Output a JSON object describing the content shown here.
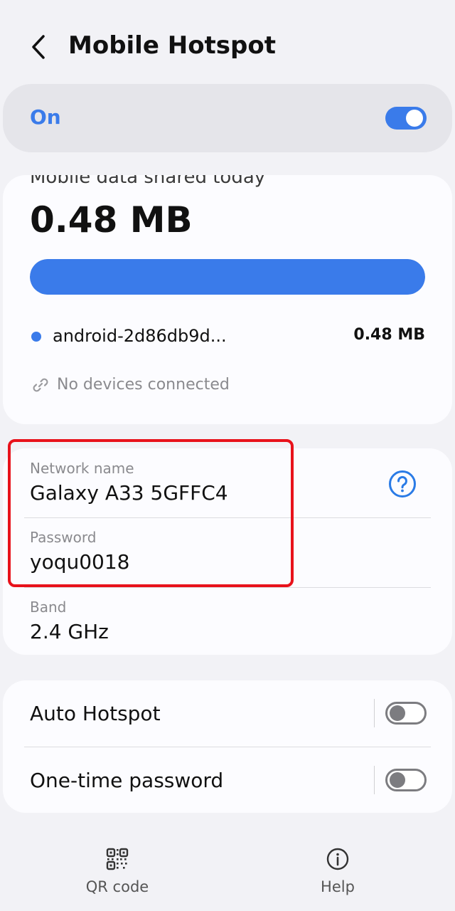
{
  "header": {
    "title": "Mobile Hotspot",
    "back_icon": "chevron-left-icon"
  },
  "master_switch": {
    "label": "On",
    "enabled": true,
    "accent_color": "#3a7bea"
  },
  "usage": {
    "caption": "Mobile data shared today",
    "total": "0.48 MB",
    "bar_fill_fraction": 1.0,
    "bar_color": "#3a7bea",
    "devices": [
      {
        "name": "android-2d86db9d...",
        "usage": "0.48 MB",
        "dot_color": "#3a7bea"
      }
    ],
    "connection_status": "No devices connected",
    "connection_icon": "link-icon"
  },
  "config": {
    "network_name_label": "Network name",
    "network_name_value": "Galaxy A33 5GFFC4",
    "password_label": "Password",
    "password_value": "yoqu0018",
    "band_label": "Band",
    "band_value": "2.4 GHz",
    "help_icon": "question-circle-icon",
    "highlight_color": "#e8121b"
  },
  "options": [
    {
      "label": "Auto Hotspot",
      "enabled": false
    },
    {
      "label": "One-time password",
      "enabled": false
    }
  ],
  "bottom_bar": {
    "qr_label": "QR code",
    "qr_icon": "qr-code-icon",
    "help_label": "Help",
    "help_icon": "info-icon"
  }
}
